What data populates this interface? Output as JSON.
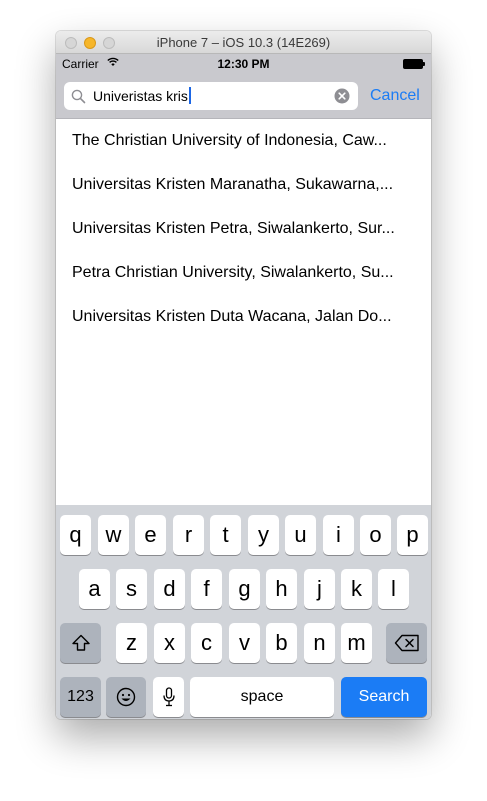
{
  "window": {
    "title": "iPhone 7 – iOS 10.3 (14E269)"
  },
  "status": {
    "carrier": "Carrier",
    "time": "12:30 PM"
  },
  "search": {
    "value": "Univeristas kris",
    "cancel_label": "Cancel"
  },
  "results": [
    "The Christian University of Indonesia, Caw...",
    "Universitas Kristen Maranatha, Sukawarna,...",
    "Universitas Kristen Petra, Siwalankerto, Sur...",
    "Petra Christian University, Siwalankerto, Su...",
    "Universitas Kristen Duta Wacana, Jalan Do..."
  ],
  "keyboard": {
    "row1": [
      "q",
      "w",
      "e",
      "r",
      "t",
      "y",
      "u",
      "i",
      "o",
      "p"
    ],
    "row2": [
      "a",
      "s",
      "d",
      "f",
      "g",
      "h",
      "j",
      "k",
      "l"
    ],
    "row3": [
      "z",
      "x",
      "c",
      "v",
      "b",
      "n",
      "m"
    ],
    "numbers_label": "123",
    "space_label": "space",
    "search_label": "Search",
    "icons": {
      "shift": "shift-icon",
      "delete": "delete-icon",
      "emoji": "emoji-icon",
      "dictation": "microphone-icon"
    }
  },
  "colors": {
    "accent": "#1b7cf5",
    "keyboard_bg": "#d1d4d9",
    "searchbar_bg": "#c9c9ce"
  }
}
